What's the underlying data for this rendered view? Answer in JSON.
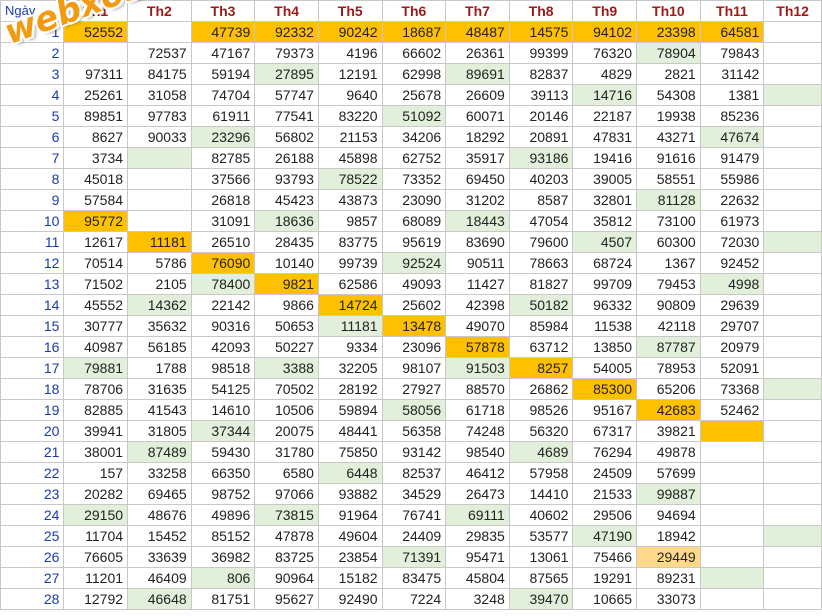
{
  "colors": {
    "green": "#e2efda",
    "orange": "#ffc000",
    "light_orange": "#ffd98a",
    "header_red": "#9b1b1b",
    "day_blue": "#1a3ab0"
  },
  "watermark": "webxoso.net",
  "header": {
    "day_label": "Ngày",
    "months": [
      "Th1",
      "Th2",
      "Th3",
      "Th4",
      "Th5",
      "Th6",
      "Th7",
      "Th8",
      "Th9",
      "Th10",
      "Th11",
      "Th12"
    ]
  },
  "rows": [
    {
      "day": "1",
      "values": [
        "52552",
        "",
        "47739",
        "92332",
        "90242",
        "18687",
        "48487",
        "14575",
        "94102",
        "23398",
        "64581",
        ""
      ],
      "hl": {
        "0": "o",
        "2": "o",
        "3": "o",
        "4": "o",
        "5": "o",
        "6": "o",
        "7": "o",
        "8": "o",
        "9": "o",
        "10": "o"
      }
    },
    {
      "day": "2",
      "values": [
        "",
        "72537",
        "47167",
        "79373",
        "4196",
        "66602",
        "26361",
        "99399",
        "76320",
        "78904",
        "79843",
        ""
      ],
      "hl": {
        "9": "g"
      }
    },
    {
      "day": "3",
      "values": [
        "97311",
        "84175",
        "59194",
        "27895",
        "12191",
        "62998",
        "89691",
        "82837",
        "4829",
        "2821",
        "31142",
        ""
      ],
      "hl": {
        "3": "g",
        "6": "g"
      }
    },
    {
      "day": "4",
      "values": [
        "25261",
        "31058",
        "74704",
        "57747",
        "9640",
        "25678",
        "26609",
        "39113",
        "14716",
        "54308",
        "1381",
        ""
      ],
      "hl": {
        "8": "g",
        "11": "g"
      }
    },
    {
      "day": "5",
      "values": [
        "89851",
        "97783",
        "61911",
        "77541",
        "83220",
        "51092",
        "60071",
        "20146",
        "22187",
        "19938",
        "85236",
        ""
      ],
      "hl": {
        "5": "g"
      }
    },
    {
      "day": "6",
      "values": [
        "8627",
        "90033",
        "23296",
        "56802",
        "21153",
        "34206",
        "18292",
        "20891",
        "47831",
        "43271",
        "47674",
        ""
      ],
      "hl": {
        "2": "g",
        "10": "g"
      }
    },
    {
      "day": "7",
      "values": [
        "3734",
        "",
        "82785",
        "26188",
        "45898",
        "62752",
        "35917",
        "93186",
        "19416",
        "91616",
        "91479",
        ""
      ],
      "hl": {
        "1": "g",
        "7": "g"
      }
    },
    {
      "day": "8",
      "values": [
        "45018",
        "",
        "37566",
        "93793",
        "78522",
        "73352",
        "69450",
        "40203",
        "39005",
        "58551",
        "55986",
        ""
      ],
      "hl": {
        "4": "g"
      }
    },
    {
      "day": "9",
      "values": [
        "57584",
        "",
        "26818",
        "45423",
        "43873",
        "23090",
        "31202",
        "8587",
        "32801",
        "81128",
        "22632",
        ""
      ],
      "hl": {
        "9": "g"
      }
    },
    {
      "day": "10",
      "values": [
        "95772",
        "",
        "31091",
        "18636",
        "9857",
        "68089",
        "18443",
        "47054",
        "35812",
        "73100",
        "61973",
        ""
      ],
      "hl": {
        "0": "o",
        "3": "g",
        "6": "g"
      }
    },
    {
      "day": "11",
      "values": [
        "12617",
        "11181",
        "26510",
        "28435",
        "83775",
        "95619",
        "83690",
        "79600",
        "4507",
        "60300",
        "72030",
        ""
      ],
      "hl": {
        "1": "o",
        "8": "g",
        "11": "g"
      }
    },
    {
      "day": "12",
      "values": [
        "70514",
        "5786",
        "76090",
        "10140",
        "99739",
        "92524",
        "90511",
        "78663",
        "68724",
        "1367",
        "92452",
        ""
      ],
      "hl": {
        "2": "o",
        "5": "g"
      }
    },
    {
      "day": "13",
      "values": [
        "71502",
        "2105",
        "78400",
        "9821",
        "62586",
        "49093",
        "11427",
        "81827",
        "99709",
        "79453",
        "4998",
        ""
      ],
      "hl": {
        "2": "g",
        "3": "o",
        "10": "g"
      }
    },
    {
      "day": "14",
      "values": [
        "45552",
        "14362",
        "22142",
        "9866",
        "14724",
        "25602",
        "42398",
        "50182",
        "96332",
        "90809",
        "29639",
        ""
      ],
      "hl": {
        "1": "g",
        "4": "o",
        "7": "g"
      }
    },
    {
      "day": "15",
      "values": [
        "30777",
        "35632",
        "90316",
        "50653",
        "11181",
        "13478",
        "49070",
        "85984",
        "11538",
        "42118",
        "29707",
        ""
      ],
      "hl": {
        "4": "g",
        "5": "o"
      }
    },
    {
      "day": "16",
      "values": [
        "40987",
        "56185",
        "42093",
        "50227",
        "9334",
        "23096",
        "57878",
        "63712",
        "13850",
        "87787",
        "20979",
        ""
      ],
      "hl": {
        "6": "o",
        "9": "g"
      }
    },
    {
      "day": "17",
      "values": [
        "79881",
        "1788",
        "98518",
        "3388",
        "32205",
        "98107",
        "91503",
        "8257",
        "54005",
        "78953",
        "52091",
        ""
      ],
      "hl": {
        "0": "g",
        "3": "g",
        "6": "g",
        "7": "o"
      }
    },
    {
      "day": "18",
      "values": [
        "78706",
        "31635",
        "54125",
        "70502",
        "28192",
        "27927",
        "88570",
        "26862",
        "85300",
        "65206",
        "73368",
        ""
      ],
      "hl": {
        "8": "o",
        "11": "g"
      }
    },
    {
      "day": "19",
      "values": [
        "82885",
        "41543",
        "14610",
        "10506",
        "59894",
        "58056",
        "61718",
        "98526",
        "95167",
        "42683",
        "52462",
        ""
      ],
      "hl": {
        "5": "g",
        "9": "o"
      }
    },
    {
      "day": "20",
      "values": [
        "39941",
        "31805",
        "37344",
        "20075",
        "48441",
        "56358",
        "74248",
        "56320",
        "67317",
        "39821",
        "",
        ""
      ],
      "hl": {
        "2": "g",
        "10": "o"
      }
    },
    {
      "day": "21",
      "values": [
        "38001",
        "87489",
        "59430",
        "31780",
        "75850",
        "93142",
        "98540",
        "4689",
        "76294",
        "49878",
        "",
        ""
      ],
      "hl": {
        "1": "g",
        "7": "g"
      }
    },
    {
      "day": "22",
      "values": [
        "157",
        "33258",
        "66350",
        "6580",
        "6448",
        "82537",
        "46412",
        "57958",
        "24509",
        "57699",
        "",
        ""
      ],
      "hl": {
        "4": "g"
      }
    },
    {
      "day": "23",
      "values": [
        "20282",
        "69465",
        "98752",
        "97066",
        "93882",
        "34529",
        "26473",
        "14410",
        "21533",
        "99887",
        "",
        ""
      ],
      "hl": {
        "9": "g"
      }
    },
    {
      "day": "24",
      "values": [
        "29150",
        "48676",
        "49896",
        "73815",
        "91964",
        "76741",
        "69111",
        "40602",
        "29506",
        "94694",
        "",
        ""
      ],
      "hl": {
        "0": "g",
        "3": "g",
        "6": "g"
      }
    },
    {
      "day": "25",
      "values": [
        "11704",
        "15452",
        "85152",
        "47878",
        "49604",
        "24409",
        "29835",
        "53577",
        "47190",
        "18942",
        "",
        ""
      ],
      "hl": {
        "8": "g",
        "11": "g"
      }
    },
    {
      "day": "26",
      "values": [
        "76605",
        "33639",
        "36982",
        "83725",
        "23854",
        "71391",
        "95471",
        "13061",
        "75466",
        "29449",
        "",
        ""
      ],
      "hl": {
        "5": "g",
        "9": "ly"
      }
    },
    {
      "day": "27",
      "values": [
        "11201",
        "46409",
        "806",
        "90964",
        "15182",
        "83475",
        "45804",
        "87565",
        "19291",
        "89231",
        "",
        ""
      ],
      "hl": {
        "2": "g",
        "10": "g"
      }
    },
    {
      "day": "28",
      "values": [
        "12792",
        "46648",
        "81751",
        "95627",
        "92490",
        "7224",
        "3248",
        "39470",
        "10665",
        "33073",
        "",
        ""
      ],
      "hl": {
        "1": "g",
        "7": "g"
      }
    }
  ]
}
